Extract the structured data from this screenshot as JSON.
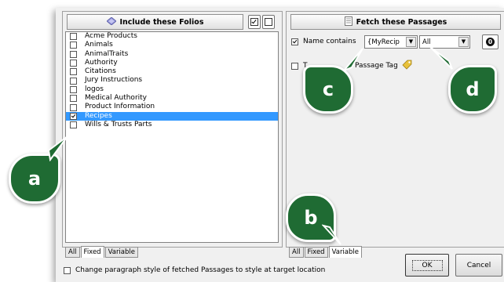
{
  "left_panel": {
    "title": "Include these Folios",
    "folios": [
      {
        "label": "Acme Products",
        "checked": false
      },
      {
        "label": "Animals",
        "checked": false
      },
      {
        "label": "AnimalTraits",
        "checked": false
      },
      {
        "label": "Authority",
        "checked": false
      },
      {
        "label": "Citations",
        "checked": false
      },
      {
        "label": "Jury Instructions",
        "checked": false
      },
      {
        "label": "logos",
        "checked": false
      },
      {
        "label": "Medical Authority",
        "checked": false
      },
      {
        "label": "Product Information",
        "checked": false
      },
      {
        "label": "Recipes",
        "checked": true,
        "selected": true
      },
      {
        "label": "Wills & Trusts Parts",
        "checked": false
      }
    ],
    "tabs": [
      "All",
      "Fixed",
      "Variable"
    ],
    "active_tab": "Fixed"
  },
  "right_panel": {
    "title": "Fetch these Passages",
    "name_contains_label": "Name contains",
    "name_contains_checked": true,
    "name_select_value": "{MyRecip",
    "scope_select_value": "All",
    "count_badge": "0",
    "tag_label_start": "T",
    "tag_label_end": "Passage Tag",
    "tag_checked": false,
    "tabs": [
      "All",
      "Fixed",
      "Variable"
    ],
    "active_tab": "Variable"
  },
  "footer": {
    "change_style_label": "Change paragraph style of fetched Passages to style at target location",
    "ok_label": "OK",
    "cancel_label": "Cancel"
  },
  "callouts": {
    "a": "a",
    "b": "b",
    "c": "c",
    "d": "d"
  },
  "colors": {
    "callout": "#1f6b33",
    "selection": "#3399ff"
  }
}
